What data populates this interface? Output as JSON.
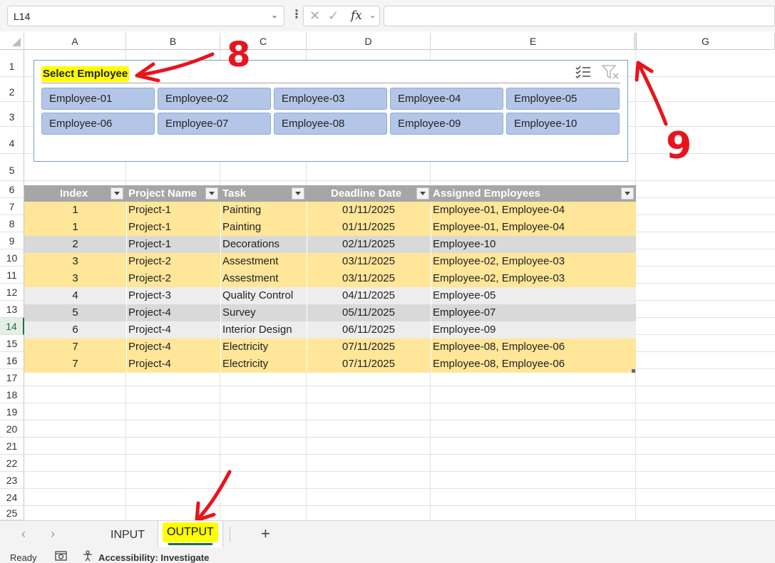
{
  "formula_bar": {
    "name_box": "L14",
    "fx_label": "fx",
    "formula": ""
  },
  "columns": [
    {
      "label": "A"
    },
    {
      "label": "B"
    },
    {
      "label": "C"
    },
    {
      "label": "D"
    },
    {
      "label": "E"
    },
    {
      "label": "G"
    }
  ],
  "rows": [
    "1",
    "2",
    "3",
    "4",
    "5",
    "6",
    "7",
    "8",
    "9",
    "10",
    "11",
    "12",
    "13",
    "14",
    "15",
    "16",
    "17",
    "18",
    "19",
    "20",
    "21",
    "22",
    "23",
    "24",
    "25"
  ],
  "selected_row": "14",
  "slicer": {
    "title": "Select Employee",
    "multi_select_icon": "multi-select-icon",
    "clear_filter_icon": "clear-filter-icon",
    "items": [
      "Employee-01",
      "Employee-02",
      "Employee-03",
      "Employee-04",
      "Employee-05",
      "Employee-06",
      "Employee-07",
      "Employee-08",
      "Employee-09",
      "Employee-10"
    ]
  },
  "table": {
    "headers": [
      "Index",
      "Project Name",
      "Task",
      "Deadline Date",
      "Assigned Employees"
    ],
    "rows": [
      {
        "index": "1",
        "project": "Project-1",
        "task": "Painting",
        "deadline": "01/11/2025",
        "employees": "Employee-01, Employee-04",
        "color": "#ffe699"
      },
      {
        "index": "1",
        "project": "Project-1",
        "task": "Painting",
        "deadline": "01/11/2025",
        "employees": "Employee-01, Employee-04",
        "color": "#ffe699"
      },
      {
        "index": "2",
        "project": "Project-1",
        "task": "Decorations",
        "deadline": "02/11/2025",
        "employees": "Employee-10",
        "color": "#d9d9d9"
      },
      {
        "index": "3",
        "project": "Project-2",
        "task": "Assestment",
        "deadline": "03/11/2025",
        "employees": "Employee-02, Employee-03",
        "color": "#ffe699"
      },
      {
        "index": "3",
        "project": "Project-2",
        "task": "Assestment",
        "deadline": "03/11/2025",
        "employees": "Employee-02, Employee-03",
        "color": "#ffe699"
      },
      {
        "index": "4",
        "project": "Project-3",
        "task": "Quality Control",
        "deadline": "04/11/2025",
        "employees": "Employee-05",
        "color": "#ededed"
      },
      {
        "index": "5",
        "project": "Project-4",
        "task": "Survey",
        "deadline": "05/11/2025",
        "employees": "Employee-07",
        "color": "#d9d9d9"
      },
      {
        "index": "6",
        "project": "Project-4",
        "task": "Interior Design",
        "deadline": "06/11/2025",
        "employees": "Employee-09",
        "color": "#ededed"
      },
      {
        "index": "7",
        "project": "Project-4",
        "task": "Electricity",
        "deadline": "07/11/2025",
        "employees": "Employee-08, Employee-06",
        "color": "#ffe699"
      },
      {
        "index": "7",
        "project": "Project-4",
        "task": "Electricity",
        "deadline": "07/11/2025",
        "employees": "Employee-08, Employee-06",
        "color": "#ffe699"
      }
    ]
  },
  "annotations": {
    "label_8": "8",
    "label_9": "9",
    "color": "#e8141c"
  },
  "sheet_tabs": {
    "tabs": [
      "INPUT",
      "OUTPUT"
    ],
    "active": "OUTPUT",
    "add_label": "+"
  },
  "status_bar": {
    "ready": "Ready",
    "accessibility": "Accessibility: Investigate"
  },
  "colors": {
    "slicer_button": "#b4c6e7",
    "table_header": "#a6a6a6",
    "highlight": "#ffff00",
    "excel_green": "#1e7145"
  }
}
